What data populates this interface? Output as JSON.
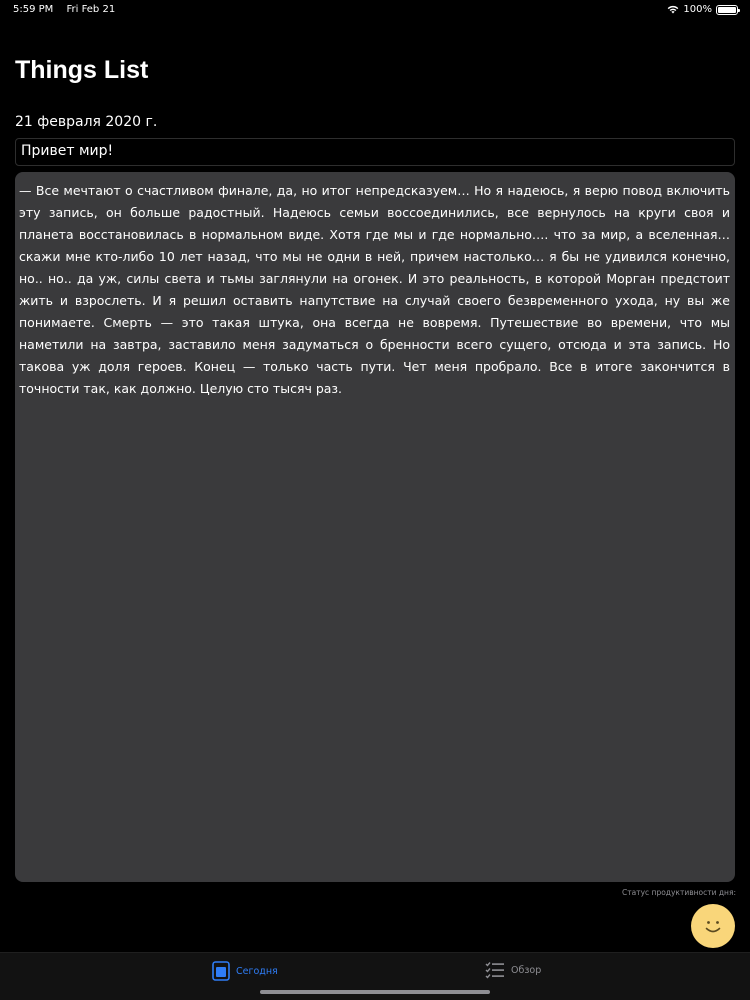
{
  "status_bar": {
    "time": "5:59 PM",
    "date": "Fri Feb 21",
    "battery": "100%"
  },
  "header": {
    "title": "Things List",
    "date": "21 февраля 2020 г."
  },
  "entry": {
    "title": "Привет мир!",
    "body": "— Все мечтают о счастливом финале, да, но итог непредсказуем… Но я надеюсь, я верю повод включить эту запись, он больше радостный. Надеюсь семьи воссоединились, все вернулось на круги своя и планета восстановилась в нормальном виде. Хотя где мы и где нормально…. что за мир, а вселенная… скажи мне кто-либо 10 лет назад, что мы не одни в ней, причем настолько… я бы не удивился конечно, но.. но.. да уж, силы света и тьмы заглянули на огонек. И это реальность, в которой Морган предстоит жить и взрослеть. И я решил оставить напутствие на случай своего безвременного ухода, ну вы же понимаете. Смерть — это такая штука, она всегда не вовремя. Путешествие во времени, что мы наметили на завтра, заставило меня задуматься о бренности всего сущего, отсюда и эта запись. Но такова уж доля героев. Конец — только часть пути. Чет меня пробрало. Все в итоге закончится в точности так, как должно. Целую сто тысяч раз."
  },
  "productivity": {
    "label": "Статус продуктивности дня:",
    "mood_icon": "smiley-face-icon"
  },
  "tab_bar": {
    "today_label": "Сегодня",
    "overview_label": "Обзор",
    "active_color": "#2f7df6",
    "inactive_color": "#8e8e93"
  },
  "colors": {
    "background": "#000000",
    "note_background": "#3a3a3c",
    "mood": "#f9d67a"
  }
}
